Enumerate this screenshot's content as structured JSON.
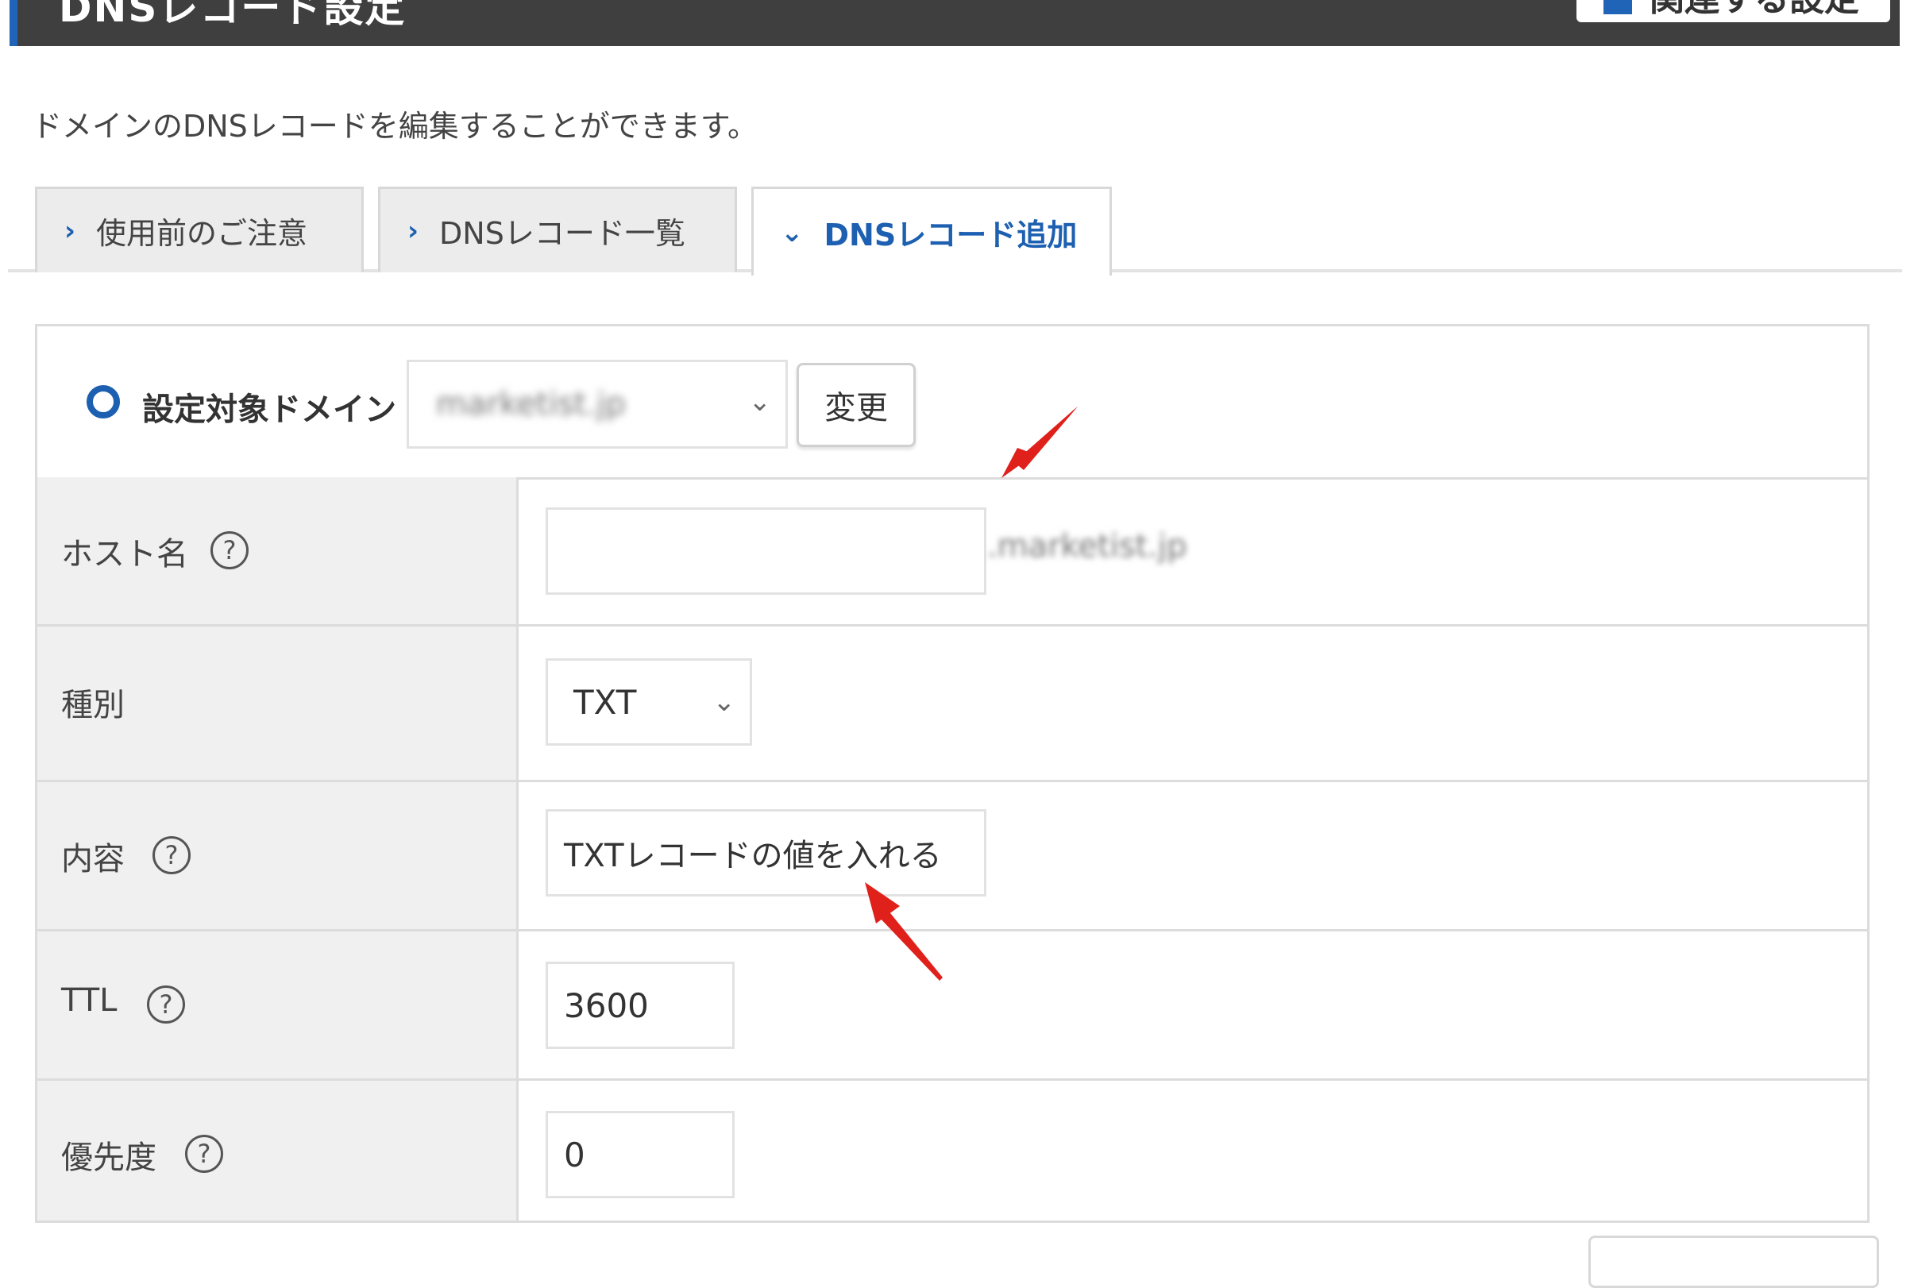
{
  "header": {
    "title": "DNSレコード設定",
    "button_label": "関連する設定"
  },
  "description": "ドメインのDNSレコードを編集することができます。",
  "tabs": [
    {
      "label": "使用前のご注意",
      "chevron": "›",
      "active": false
    },
    {
      "label": "DNSレコード一覧",
      "chevron": "›",
      "active": false
    },
    {
      "label": "DNSレコード追加",
      "chevron": "⌄",
      "active": true
    }
  ],
  "domain": {
    "label": "設定対象ドメイン",
    "selected_value": "marketist.jp",
    "change_button": "変更"
  },
  "form": {
    "host": {
      "label": "ホスト名",
      "value": "",
      "suffix": ".marketist.jp"
    },
    "type": {
      "label": "種別",
      "value": "TXT"
    },
    "content": {
      "label": "内容",
      "value": "TXTレコードの値を入れる"
    },
    "ttl": {
      "label": "TTL",
      "value": "3600"
    },
    "priority": {
      "label": "優先度",
      "value": "0"
    }
  },
  "icons": {
    "help": "?",
    "select_chevron": "⌄"
  },
  "colors": {
    "accent": "#1d5fb0",
    "header_bg": "#3f3f3f",
    "annotation_arrow": "#e0201b"
  }
}
